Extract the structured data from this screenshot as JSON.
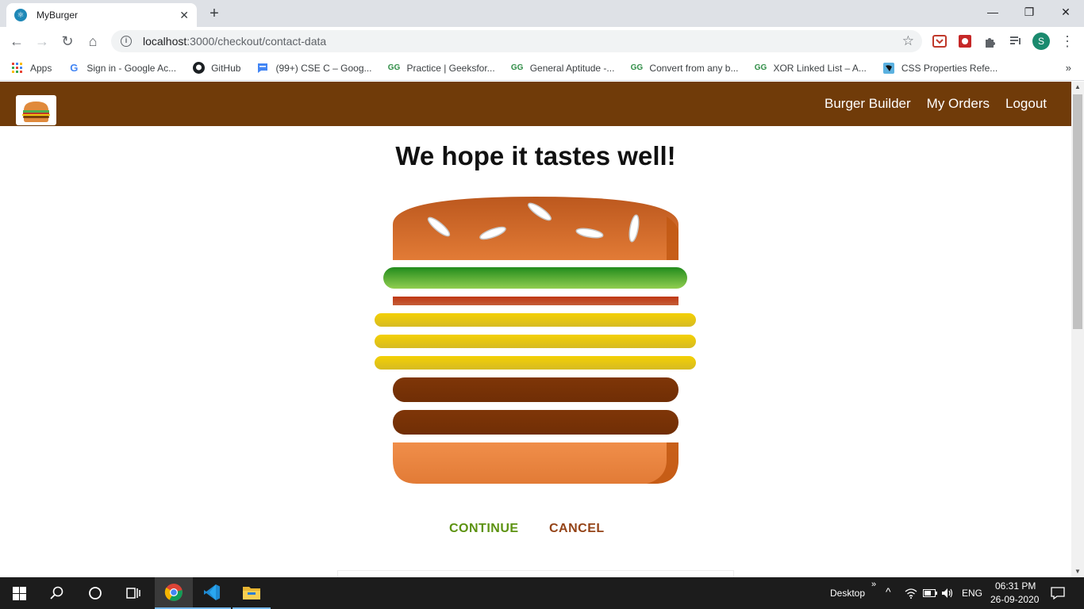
{
  "browser": {
    "tab_title": "MyBurger",
    "url_host": "localhost",
    "url_rest": ":3000/checkout/contact-data",
    "profile_initial": "S"
  },
  "bookmarks": [
    {
      "label": "Apps",
      "icon": "apps-grid-icon"
    },
    {
      "label": "Sign in - Google Ac...",
      "icon": "google-icon"
    },
    {
      "label": "GitHub",
      "icon": "github-icon"
    },
    {
      "label": "(99+) CSE C – Goog...",
      "icon": "google-chat-icon"
    },
    {
      "label": "Practice | Geeksfor...",
      "icon": "geeksforgeeks-icon"
    },
    {
      "label": "General Aptitude -...",
      "icon": "geeksforgeeks-icon"
    },
    {
      "label": "Convert from any b...",
      "icon": "geeksforgeeks-icon"
    },
    {
      "label": "XOR Linked List – A...",
      "icon": "geeksforgeeks-icon"
    },
    {
      "label": "CSS Properties Refe...",
      "icon": "css-icon"
    }
  ],
  "app": {
    "nav": [
      "Burger Builder",
      "My Orders",
      "Logout"
    ],
    "heading": "We hope it tastes well!",
    "continue_label": "CONTINUE",
    "cancel_label": "CANCEL",
    "burger_layers": [
      "bread-top",
      "salad",
      "bacon",
      "cheese",
      "cheese",
      "cheese",
      "meat",
      "meat",
      "bread-bottom"
    ],
    "colors": {
      "toolbar": "#703b09",
      "continue": "#5c9210",
      "cancel": "#944317"
    }
  },
  "taskbar": {
    "desktop_label": "Desktop",
    "language": "ENG",
    "time": "06:31 PM",
    "date": "26-09-2020"
  }
}
